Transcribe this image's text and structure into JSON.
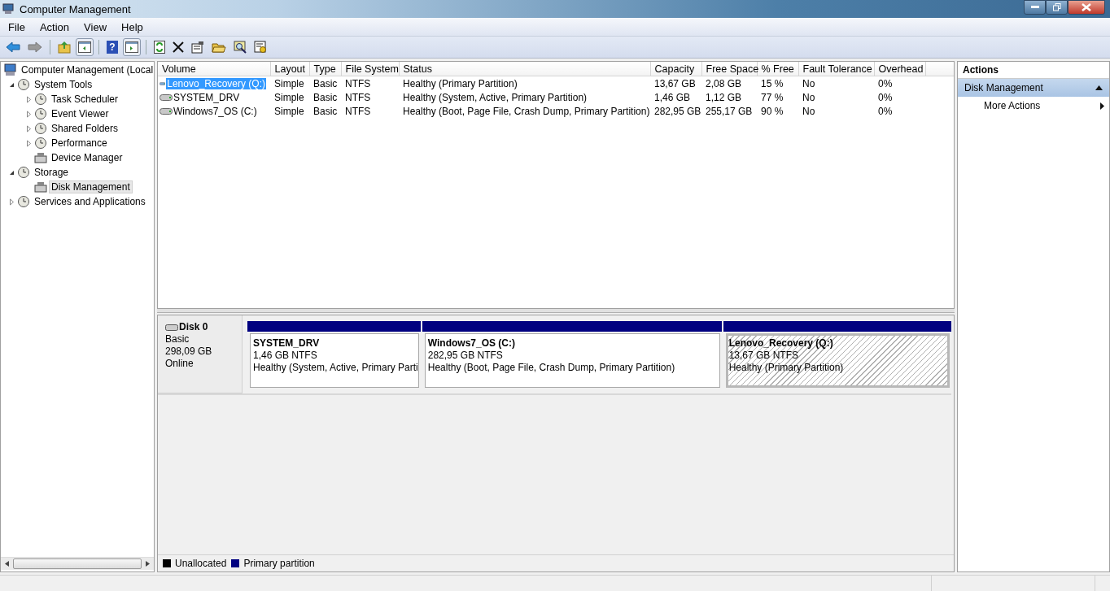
{
  "window": {
    "title": "Computer Management"
  },
  "menu": [
    "File",
    "Action",
    "View",
    "Help"
  ],
  "nav_buttons": [
    {
      "disabled": false
    },
    {
      "disabled": true
    }
  ],
  "help_glyph": "?",
  "tree": [
    {
      "label": "Computer Management (Local",
      "kind": "root",
      "selected": false,
      "children": [
        {
          "label": "System Tools",
          "kind": "branch",
          "expanded": true,
          "selected": false,
          "children": [
            {
              "label": "Task Scheduler",
              "kind": "branch",
              "expanded": false,
              "selected": false
            },
            {
              "label": "Event Viewer",
              "kind": "branch",
              "expanded": false,
              "selected": false
            },
            {
              "label": "Shared Folders",
              "kind": "branch",
              "expanded": false,
              "selected": false
            },
            {
              "label": "Performance",
              "kind": "branch",
              "expanded": false,
              "selected": false
            },
            {
              "label": "Device Manager",
              "kind": "leaf",
              "selected": false
            }
          ]
        },
        {
          "label": "Storage",
          "kind": "branch",
          "expanded": true,
          "selected": false,
          "children": [
            {
              "label": "Disk Management",
              "kind": "leaf",
              "selected": true
            }
          ]
        },
        {
          "label": "Services and Applications",
          "kind": "branch",
          "expanded": false,
          "selected": false
        }
      ]
    }
  ],
  "volume_table": {
    "columns": [
      "Volume",
      "Layout",
      "Type",
      "File System",
      "Status",
      "Capacity",
      "Free Space",
      "% Free",
      "Fault Tolerance",
      "Overhead"
    ],
    "rows": [
      {
        "selected": true,
        "cells": [
          "Lenovo_Recovery (Q:)",
          "Simple",
          "Basic",
          "NTFS",
          "Healthy (Primary Partition)",
          "13,67 GB",
          "2,08 GB",
          "15 %",
          "No",
          "0%"
        ]
      },
      {
        "selected": false,
        "cells": [
          "SYSTEM_DRV",
          "Simple",
          "Basic",
          "NTFS",
          "Healthy (System, Active, Primary Partition)",
          "1,46 GB",
          "1,12 GB",
          "77 %",
          "No",
          "0%"
        ]
      },
      {
        "selected": false,
        "cells": [
          "Windows7_OS (C:)",
          "Simple",
          "Basic",
          "NTFS",
          "Healthy (Boot, Page File, Crash Dump, Primary Partition)",
          "282,95 GB",
          "255,17 GB",
          "90 %",
          "No",
          "0%"
        ]
      }
    ]
  },
  "disks": [
    {
      "name": "Disk 0",
      "type": "Basic",
      "size": "298,09 GB",
      "status": "Online",
      "partitions": [
        {
          "name": "SYSTEM_DRV",
          "size": "1,46 GB NTFS",
          "status": "Healthy (System, Active, Primary Parti",
          "kind": "primary",
          "selected": false
        },
        {
          "name": "Windows7_OS  (C:)",
          "size": "282,95 GB NTFS",
          "status": "Healthy (Boot, Page File, Crash Dump, Primary Partition)",
          "kind": "primary",
          "selected": false
        },
        {
          "name": "Lenovo_Recovery  (Q:)",
          "size": "13,67 GB NTFS",
          "status": "Healthy (Primary Partition)",
          "kind": "primary",
          "selected": true
        }
      ]
    }
  ],
  "legend": [
    {
      "label": "Unallocated",
      "color": "#000000"
    },
    {
      "label": "Primary partition",
      "color": "#000080"
    }
  ],
  "actions": {
    "title": "Actions",
    "sections": [
      {
        "title": "Disk Management",
        "expanded": true,
        "items": [
          "More Actions"
        ]
      }
    ]
  }
}
